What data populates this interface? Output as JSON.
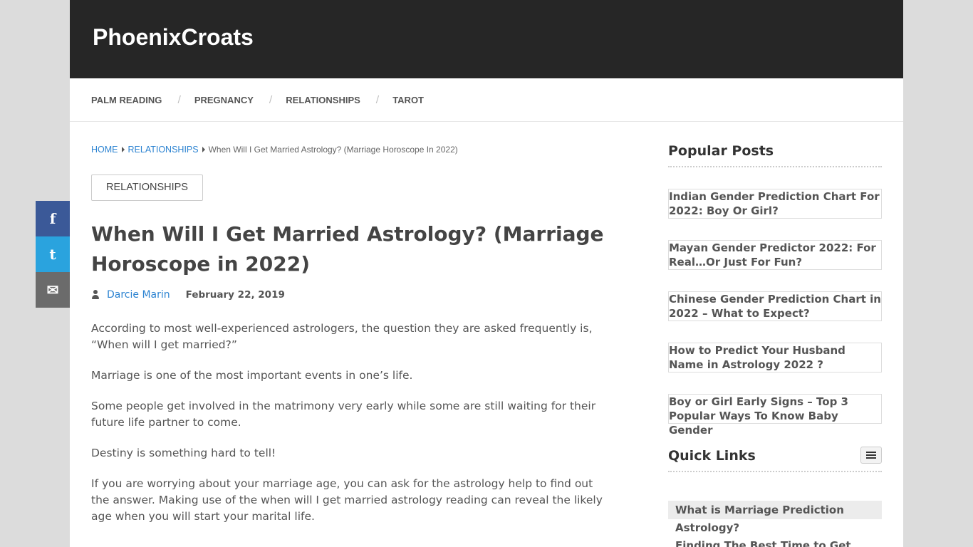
{
  "site": {
    "logo": "PhoenixCroats"
  },
  "nav": {
    "items": [
      {
        "label": "PALM READING"
      },
      {
        "label": "PREGNANCY"
      },
      {
        "label": "RELATIONSHIPS"
      },
      {
        "label": "TAROT"
      }
    ],
    "separator": "/"
  },
  "breadcrumb": {
    "home": "HOME",
    "category": "RELATIONSHIPS",
    "current": "When Will I Get Married Astrology? (Marriage Horoscope In 2022)"
  },
  "article": {
    "category_label": "RELATIONSHIPS",
    "title": "When Will I Get Married Astrology? (Marriage Horoscope in 2022)",
    "author": "Darcie Marin",
    "date": "February 22, 2019",
    "paragraphs": [
      "According to most well-experienced astrologers, the question they are asked frequently is, “When will I get married?”",
      "Marriage is one of the most important events in one’s life.",
      "Some people get involved in the matrimony very early while some are still waiting for their future life partner to come.",
      "Destiny is something hard to tell!",
      "If you are worrying about your marriage age, you can ask for the astrology help to find out the answer. Making use of the when will I get married astrology reading can reveal the likely age when you will start your marital life."
    ]
  },
  "sidebar": {
    "popular_title": "Popular Posts",
    "popular_posts": [
      "Indian Gender Prediction Chart For 2022: Boy Or Girl?",
      "Mayan Gender Predictor 2022: For Real…Or Just For Fun?",
      "Chinese Gender Prediction Chart in 2022 – What to Expect?",
      "How to Predict Your Husband Name in Astrology 2022 ?",
      "Boy or Girl Early Signs – Top 3 Popular Ways To Know Baby Gender"
    ],
    "quick_title": "Quick Links",
    "quick_links": [
      "What is Marriage Prediction",
      "Astrology?",
      "Finding The Best Time to Get"
    ]
  },
  "share": {
    "facebook": "f",
    "twitter": "t",
    "email": "✉"
  },
  "colors": {
    "header_bg": "#262626",
    "link": "#2c83d1",
    "facebook": "#3b5998",
    "twitter": "#2aa3de",
    "email": "#6b6b6b"
  }
}
